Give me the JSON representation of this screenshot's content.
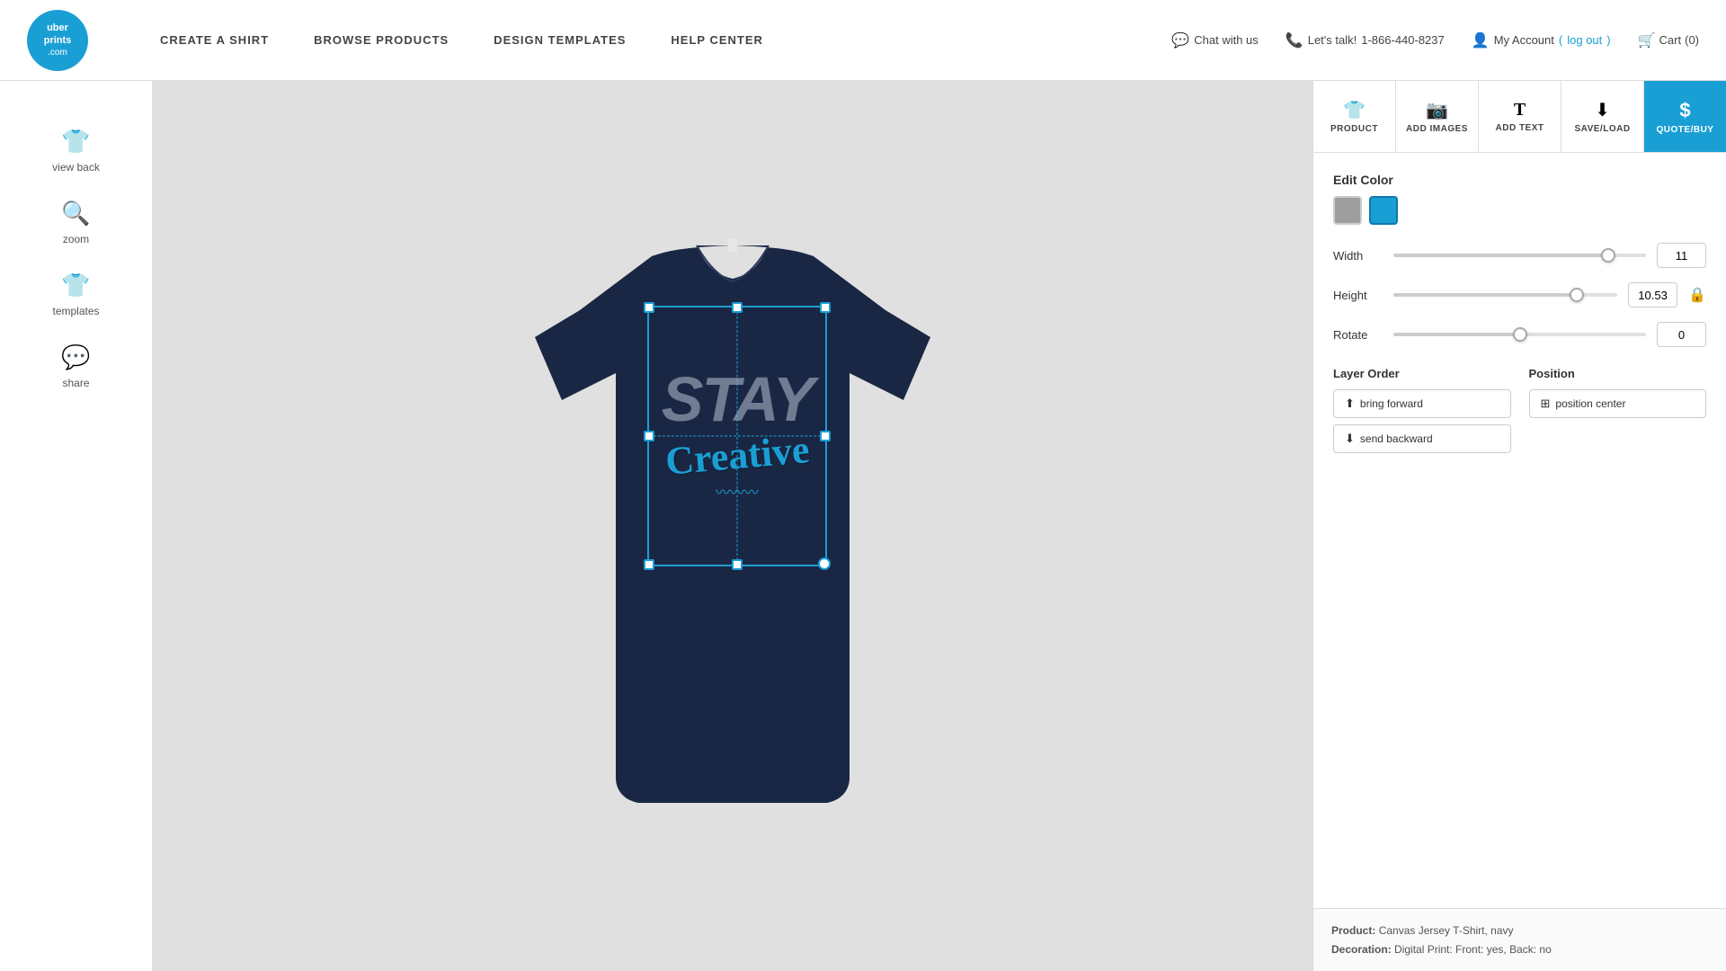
{
  "header": {
    "logo": {
      "line1": "uber",
      "line2": "prints",
      "line3": ".com"
    },
    "nav": [
      {
        "id": "create-shirt",
        "label": "CREATE A SHIRT"
      },
      {
        "id": "browse-products",
        "label": "BROWSE PRODUCTS"
      },
      {
        "id": "design-templates",
        "label": "DESIGN TEMPLATES"
      },
      {
        "id": "help-center",
        "label": "HELP CENTER"
      }
    ],
    "top_links": {
      "chat": "Chat with us",
      "phone_label": "Let's talk!",
      "phone_number": "1-866-440-8237",
      "account": "My Account",
      "logout": "log out",
      "cart": "Cart",
      "cart_count": "(0)"
    }
  },
  "sidebar": {
    "items": [
      {
        "id": "view-back",
        "icon": "👕",
        "label": "view back"
      },
      {
        "id": "zoom",
        "icon": "🔍",
        "label": "zoom"
      },
      {
        "id": "templates",
        "icon": "👕",
        "label": "templates"
      },
      {
        "id": "share",
        "icon": "💬",
        "label": "share"
      }
    ]
  },
  "toolbar": {
    "tabs": [
      {
        "id": "product",
        "icon": "👕",
        "label": "Product",
        "active": false
      },
      {
        "id": "add-images",
        "icon": "📷",
        "label": "Add Images",
        "active": false
      },
      {
        "id": "add-text",
        "icon": "T",
        "label": "Add Text",
        "active": false
      },
      {
        "id": "save-load",
        "icon": "⬇",
        "label": "Save/Load",
        "active": false
      },
      {
        "id": "quote-buy",
        "icon": "$",
        "label": "Quote/Buy",
        "active": true
      }
    ]
  },
  "panel": {
    "edit_color_label": "Edit Color",
    "colors": [
      {
        "id": "gray",
        "css_class": "gray"
      },
      {
        "id": "blue",
        "css_class": "blue"
      }
    ],
    "width_label": "Width",
    "width_value": "11",
    "width_percent": 85,
    "height_label": "Height",
    "height_value": "10.53",
    "height_percent": 82,
    "rotate_label": "Rotate",
    "rotate_value": "0",
    "rotate_percent": 50,
    "layer_order_label": "Layer Order",
    "position_label": "Position",
    "bring_forward_label": "bring forward",
    "send_backward_label": "send backward",
    "position_center_label": "position center"
  },
  "product_info": {
    "product_label": "Product:",
    "product_value": "Canvas Jersey T-Shirt, navy",
    "decoration_label": "Decoration:",
    "decoration_value": "Digital Print: Front: yes, Back: no"
  },
  "design": {
    "stay_text": "STAY",
    "creative_text": "Creative"
  }
}
